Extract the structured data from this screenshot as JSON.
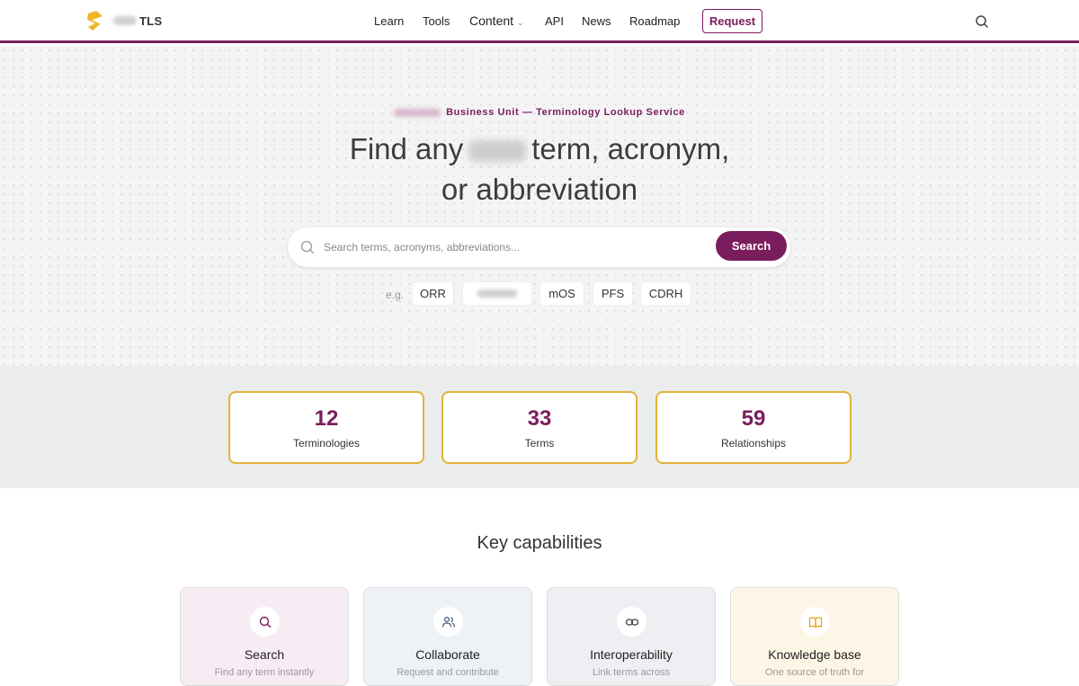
{
  "header": {
    "logo_text": "TLS",
    "nav": [
      {
        "label": "Learn"
      },
      {
        "label": "Tools"
      },
      {
        "label": "Content"
      },
      {
        "label": "API"
      },
      {
        "label": "News"
      },
      {
        "label": "Roadmap"
      }
    ],
    "request_label": "Request"
  },
  "hero": {
    "eyebrow": "Business Unit — Terminology Lookup Service",
    "title_part1": "Find any",
    "title_part2": "term, acronym,",
    "title_line2": "or abbreviation",
    "search_placeholder": "Search terms, acronyms, abbreviations...",
    "search_button": "Search",
    "examples_label": "e.g.",
    "examples": [
      "ORR",
      "mOS",
      "PFS",
      "CDRH"
    ]
  },
  "stats": [
    {
      "value": "12",
      "label": "Terminologies"
    },
    {
      "value": "33",
      "label": "Terms"
    },
    {
      "value": "59",
      "label": "Relationships"
    }
  ],
  "capabilities": {
    "title": "Key capabilities",
    "cards": [
      {
        "title": "Search",
        "subtitle": "Find any term instantly",
        "icon": "search-icon",
        "bg": "#f7ecf3"
      },
      {
        "title": "Collaborate",
        "subtitle": "Request and contribute",
        "icon": "people-icon",
        "bg": "#eef1f5"
      },
      {
        "title": "Interoperability",
        "subtitle": "Link terms across",
        "icon": "link-icon",
        "bg": "#efeff3"
      },
      {
        "title": "Knowledge base",
        "subtitle": "One source of truth for",
        "icon": "book-icon",
        "bg": "#fdf6e6"
      }
    ]
  },
  "colors": {
    "brand": "#7a1d5c",
    "accent_gold": "#e2b23a",
    "logo": "#f0b429"
  }
}
